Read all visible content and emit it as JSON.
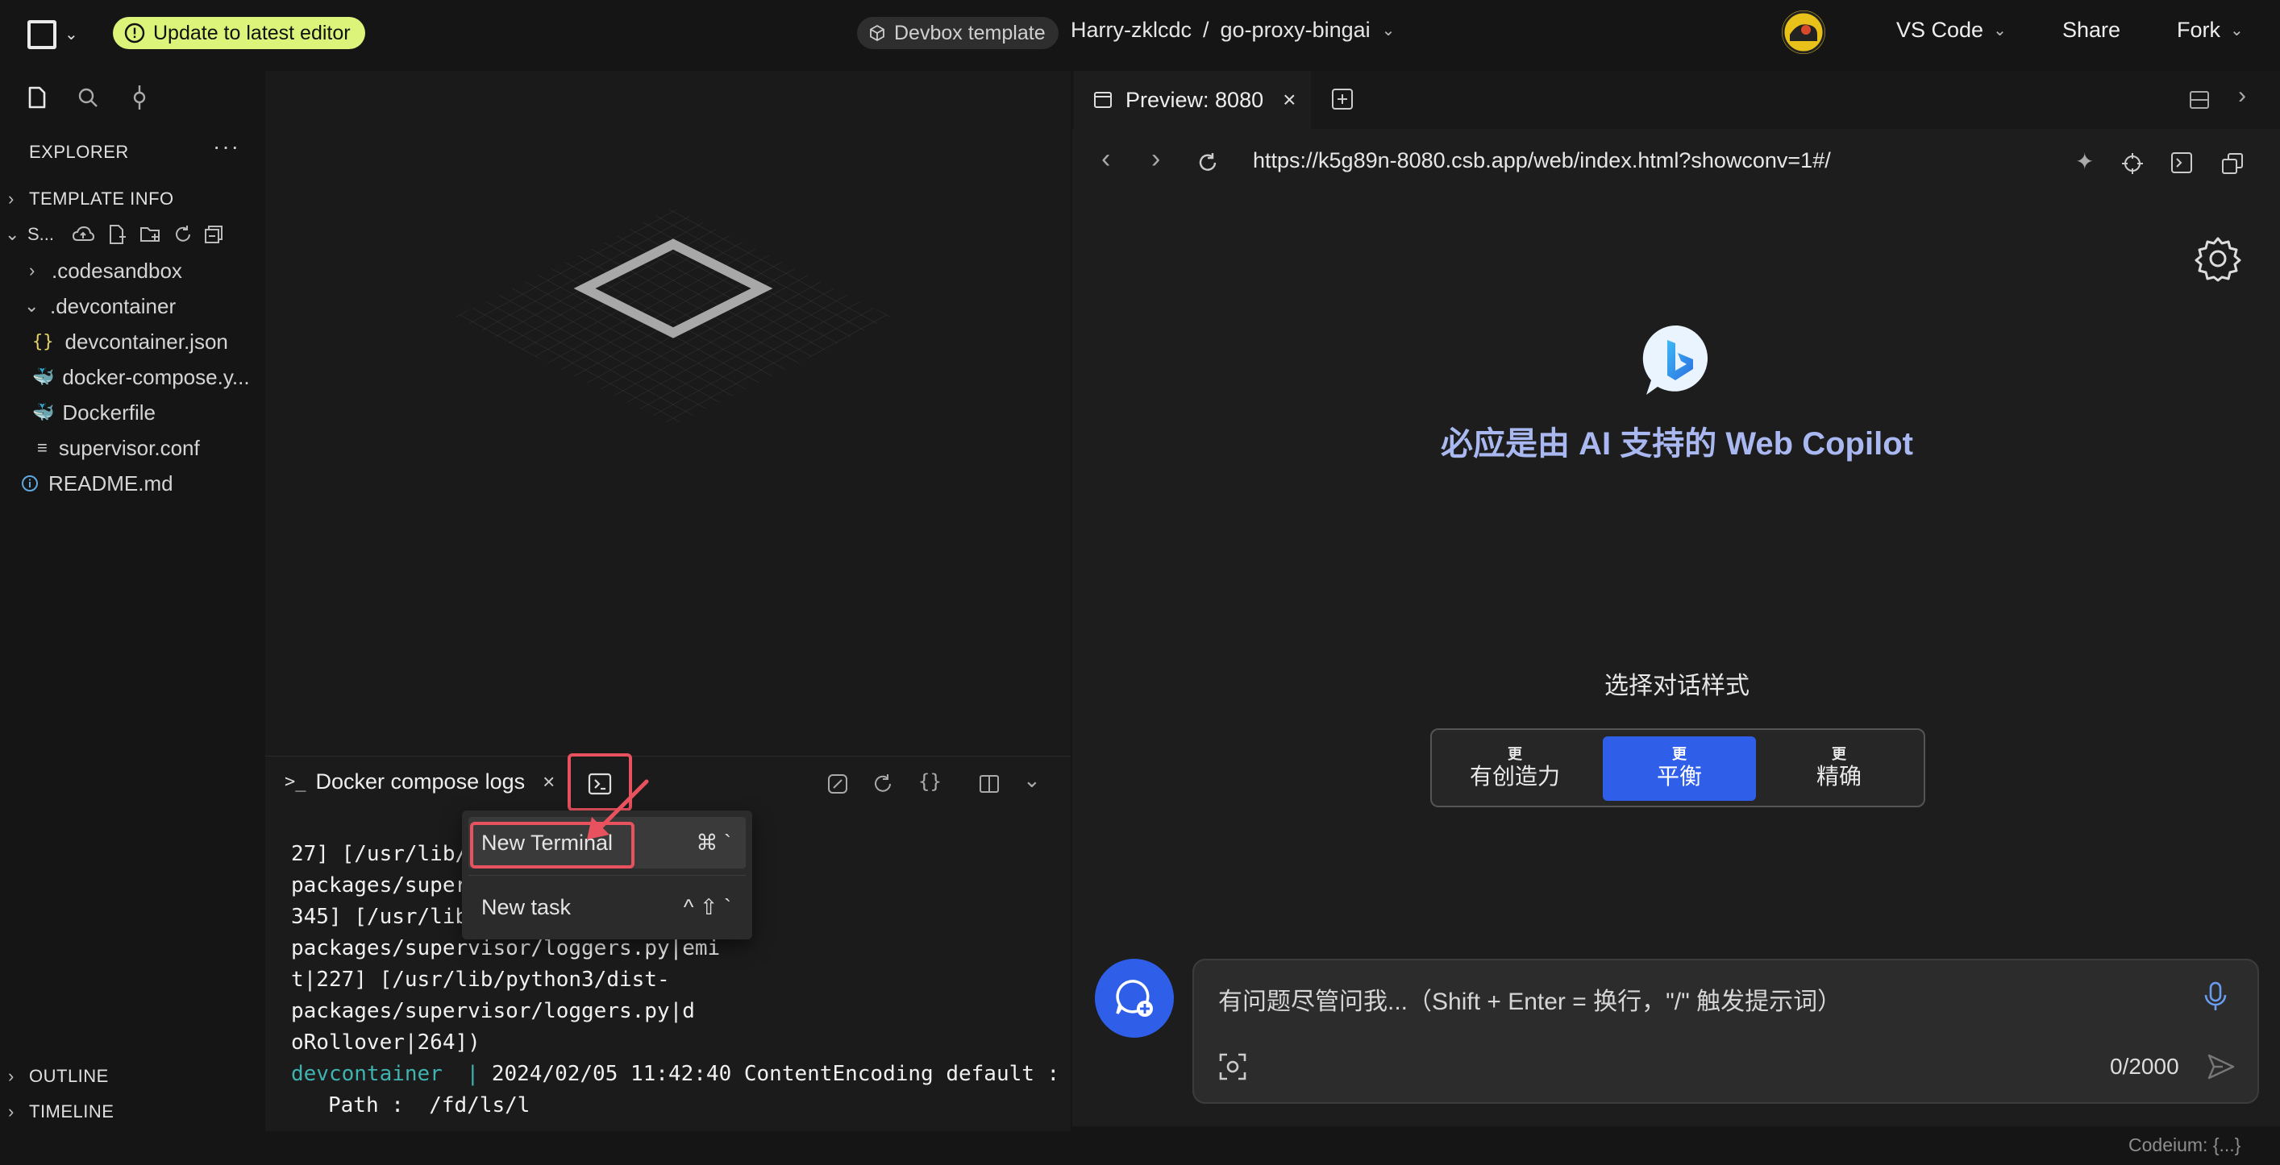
{
  "topbar": {
    "update_label": "Update to latest editor",
    "devbox_label": "Devbox template",
    "workspace_owner": "Harry-zklcdc",
    "breadcrumb_sep": "/",
    "repo": "go-proxy-bingai",
    "vscode_label": "VS Code",
    "share_label": "Share",
    "fork_label": "Fork"
  },
  "sidebar": {
    "explorer_title": "EXPLORER",
    "template_info": "TEMPLATE INFO",
    "sandbox_short": "S...",
    "tree": [
      {
        "label": ".codesandbox",
        "type": "folder",
        "open": false
      },
      {
        "label": ".devcontainer",
        "type": "folder",
        "open": true
      },
      {
        "label": "devcontainer.json",
        "type": "json"
      },
      {
        "label": "docker-compose.y...",
        "type": "docker"
      },
      {
        "label": "Dockerfile",
        "type": "docker"
      },
      {
        "label": "supervisor.conf",
        "type": "text"
      },
      {
        "label": "README.md",
        "type": "info"
      }
    ],
    "outline": "OUTLINE",
    "timeline": "TIMELINE"
  },
  "panel": {
    "tab_label": "Docker compose logs",
    "terminal_lines": [
      "27] [/usr/lib/python3/dist-packages/supervisor/loggers.py|log|",
      "345] [/usr/lib/python3/dist-packages/supervisor/loggers.py|emi",
      "t|227] [/usr/lib/python3/dist-packages/supervisor/loggers.py|d",
      "oRollover|264])"
    ],
    "log_service": "devcontainer",
    "log_sep": "|",
    "log_message": "2024/02/05 11:42:40 ContentEncoding default :",
    "log_path": "Path :  /fd/ls/l"
  },
  "menu": {
    "items": [
      {
        "label": "New Terminal",
        "shortcut": "⌘ `"
      },
      {
        "label": "New task",
        "shortcut": "^ ⇧ `"
      }
    ]
  },
  "preview": {
    "tab_label": "Preview: 8080",
    "url": "https://k5g89n-8080.csb.app/web/index.html?showconv=1#/",
    "heading": "必应是由 AI 支持的 Web Copilot",
    "style_prompt": "选择对话样式",
    "styles": [
      {
        "small": "更",
        "label": "有创造力",
        "selected": false
      },
      {
        "small": "更",
        "label": "平衡",
        "selected": true
      },
      {
        "small": "更",
        "label": "精确",
        "selected": false
      }
    ],
    "chat_placeholder": "有问题尽管问我...（Shift + Enter = 换行，\"/\" 触发提示词）",
    "char_count": "0/2000"
  },
  "status": {
    "codeium": "Codeium: {...}"
  },
  "colors": {
    "accent_blue": "#2f5fe8",
    "update_pill": "#dcf47a",
    "highlight_red": "#e8525f",
    "heading_blue": "#a9b8f0"
  }
}
